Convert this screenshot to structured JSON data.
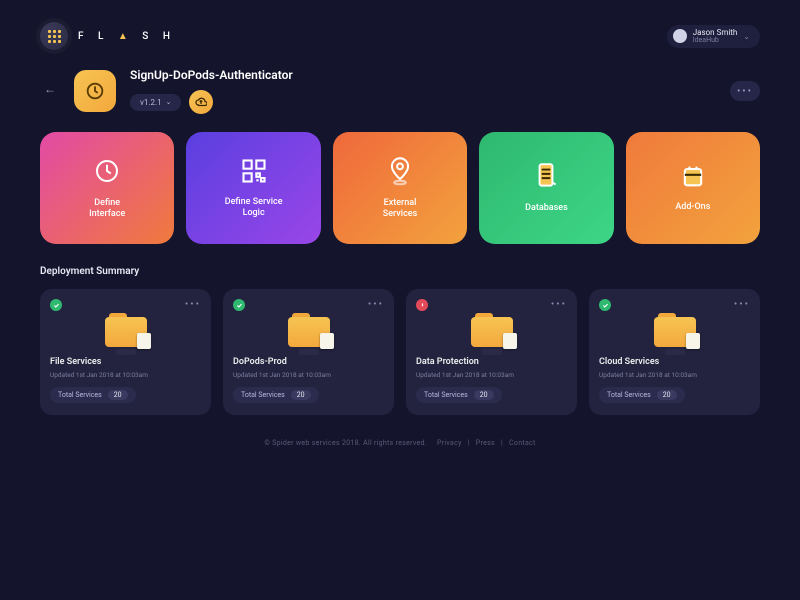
{
  "brand": {
    "text": "F L A S H"
  },
  "user": {
    "name": "Jason Smith",
    "sub": "IdeaHub"
  },
  "project": {
    "title": "SignUp-DoPods-Authenticator",
    "version": "v1.2.1"
  },
  "cards": [
    {
      "label": "Define\nInterface"
    },
    {
      "label": "Define Service\nLogic"
    },
    {
      "label": "External\nServices"
    },
    {
      "label": "Databases"
    },
    {
      "label": "Add-Ons"
    }
  ],
  "deployment": {
    "title": "Deployment Summary",
    "items": [
      {
        "name": "File Services",
        "updated": "Updated 1st Jan 2018 at 10:03am",
        "status": "ok",
        "total_label": "Total Services",
        "total": "20"
      },
      {
        "name": "DoPods-Prod",
        "updated": "Updated 1st Jan 2018 at 10:03am",
        "status": "ok",
        "total_label": "Total Services",
        "total": "20"
      },
      {
        "name": "Data Protection",
        "updated": "Updated 1st Jan 2018 at 10:03am",
        "status": "error",
        "total_label": "Total Services",
        "total": "20"
      },
      {
        "name": "Cloud Services",
        "updated": "Updated 1st Jan 2018 at 10:03am",
        "status": "ok",
        "total_label": "Total Services",
        "total": "20"
      }
    ]
  },
  "footer": {
    "copyright": "© Spider web services 2018. All rights reserved.",
    "links": [
      "Privacy",
      "Press",
      "Contact"
    ]
  }
}
